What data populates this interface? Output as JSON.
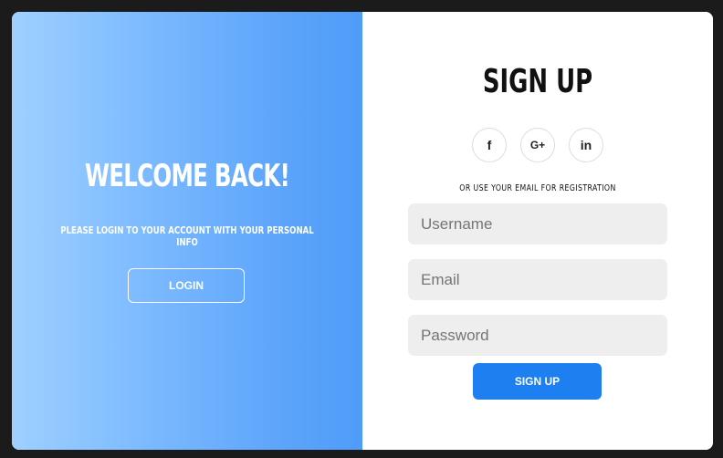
{
  "welcome": {
    "title": "WELCOME BACK!",
    "subtitle": "PLEASE LOGIN TO YOUR ACCOUNT WITH YOUR PERSONAL INFO",
    "login_label": "LOGIN"
  },
  "signup": {
    "title": "SIGN UP",
    "socials": [
      {
        "icon": "facebook-icon",
        "glyph": "f"
      },
      {
        "icon": "google-plus-icon",
        "glyph": "G+"
      },
      {
        "icon": "linkedin-icon",
        "glyph": "in"
      }
    ],
    "hint": "OR USE YOUR EMAIL FOR REGISTRATION",
    "fields": {
      "username_placeholder": "Username",
      "email_placeholder": "Email",
      "password_placeholder": "Password"
    },
    "button_label": "SIGN UP"
  },
  "colors": {
    "accent": "#1e7ff0",
    "panel_gradient_start": "#9fd0ff",
    "panel_gradient_end": "#4f9cf9",
    "input_bg": "#eeeeee"
  }
}
